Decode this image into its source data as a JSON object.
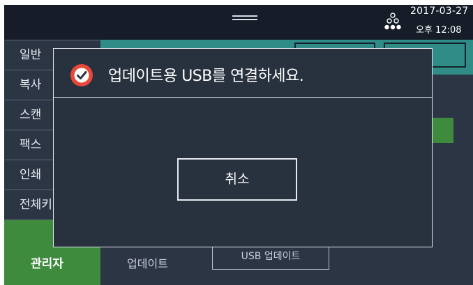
{
  "status_bar": {
    "date": "2017-03-27",
    "time": "오후 12:08",
    "network_icon": "network-icon",
    "drawer_icon": "drawer-handle-icon"
  },
  "sidebar": {
    "items": [
      {
        "label": "일반"
      },
      {
        "label": "복사"
      },
      {
        "label": "스캔"
      },
      {
        "label": "팩스"
      },
      {
        "label": "인쇄"
      },
      {
        "label": "전체키"
      },
      {
        "label": "관리자",
        "active": true
      }
    ]
  },
  "content": {
    "header_buttons": [
      "",
      ""
    ],
    "update_label": "업데이트",
    "usb_update_label": "USB 업데이트"
  },
  "dialog": {
    "icon": "check-circle-icon",
    "message": "업데이트용 USB를 연결하세요.",
    "cancel_label": "취소"
  },
  "colors": {
    "background": "#2b3544",
    "status_bar": "#161d28",
    "accent_teal": "#2f8c86",
    "active_green": "#3e8b3e",
    "dialog_icon": "#e8483a"
  }
}
